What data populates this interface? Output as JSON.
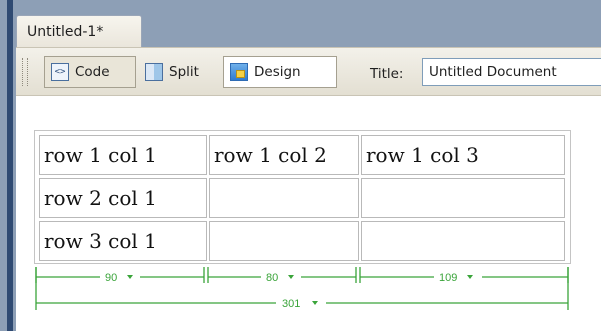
{
  "document_tab": {
    "label": "Untitled-1*"
  },
  "toolbar": {
    "code_label": "Code",
    "split_label": "Split",
    "design_label": "Design",
    "title_label": "Title:",
    "title_value": "Untitled Document"
  },
  "table": {
    "rows": [
      [
        "row 1 col 1",
        "row 1 col 2",
        "row 1 col 3"
      ],
      [
        "row 2 col 1",
        "",
        ""
      ],
      [
        "row 3 col 1",
        "",
        ""
      ]
    ]
  },
  "width_indicators": {
    "col1": "90",
    "col2": "80",
    "col3": "109",
    "total": "301"
  },
  "colors": {
    "indicator": "#3aa43a",
    "frame": "#8d9fb6"
  }
}
